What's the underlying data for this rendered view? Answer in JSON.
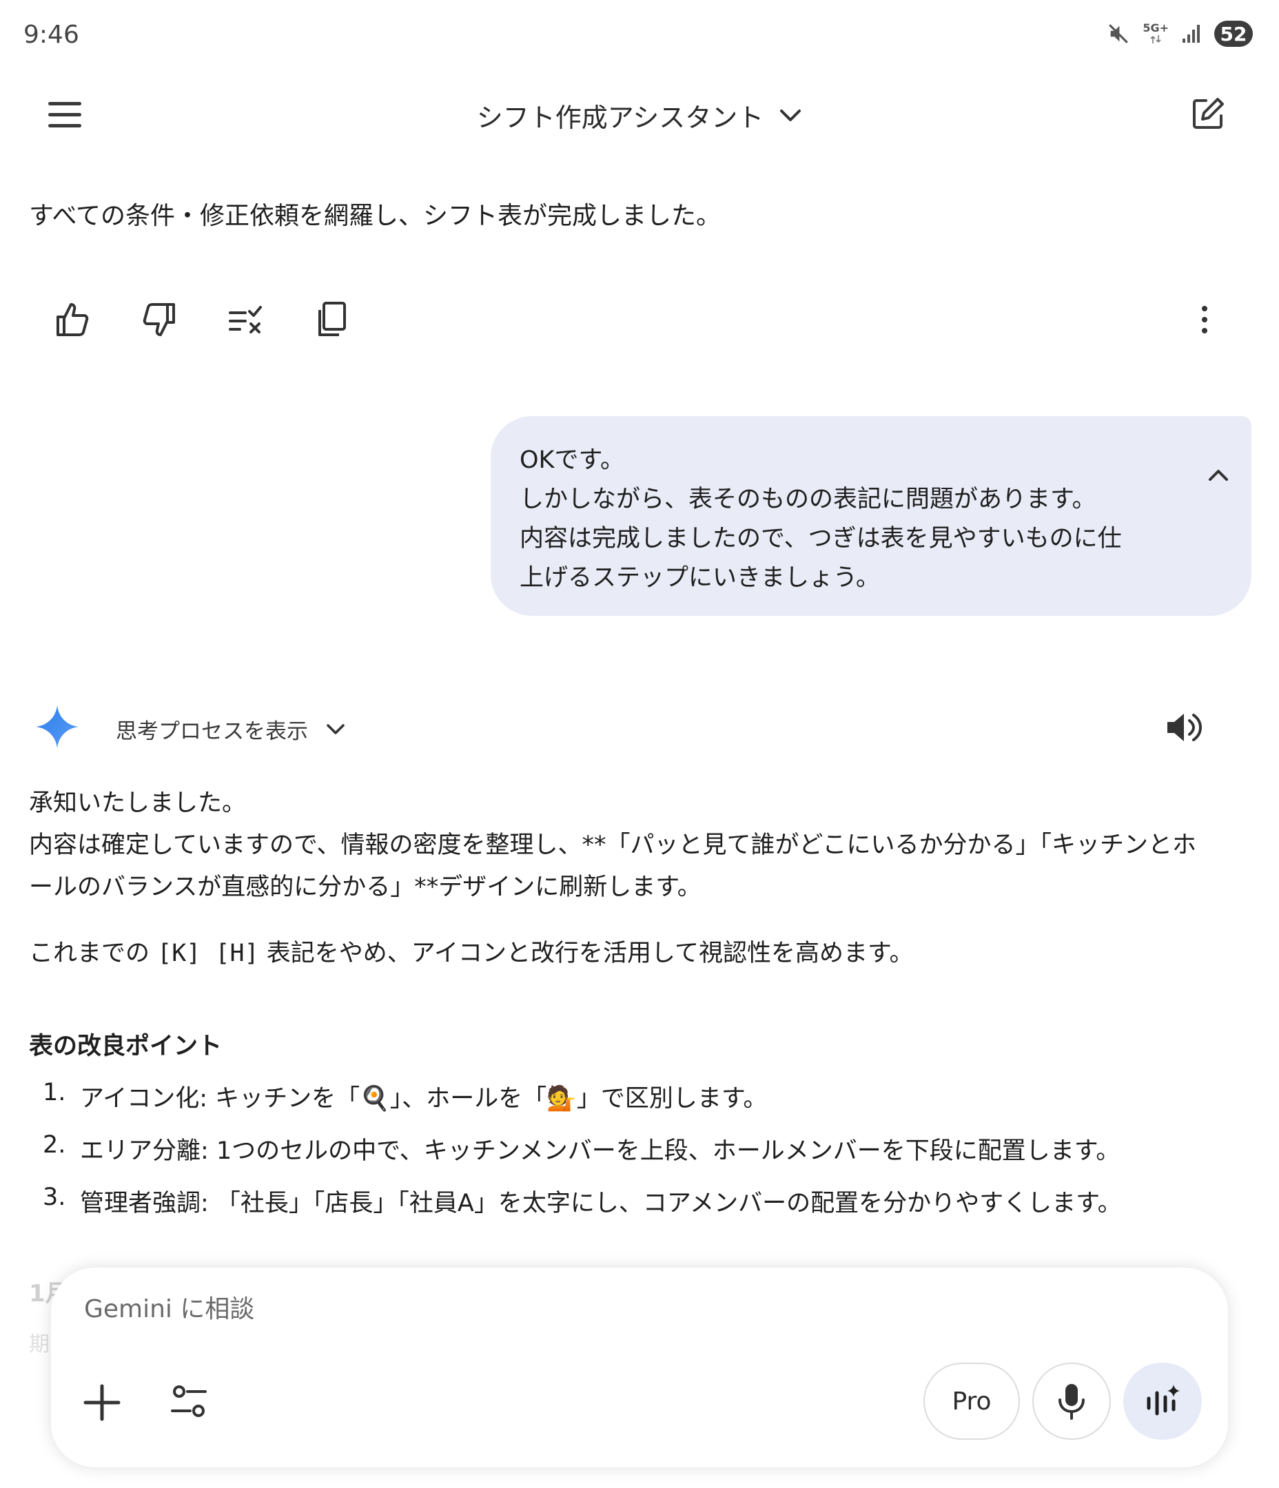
{
  "status_bar": {
    "time": "9:46",
    "network": "5G+",
    "battery": "52"
  },
  "header": {
    "title": "シフト作成アシスタント"
  },
  "conversation": {
    "bot_message_1": "すべての条件・修正依頼を網羅し、シフト表が完成しました。",
    "user_message": [
      "OKです。",
      "しかしながら、表そのものの表記に問題があります。",
      "内容は完成しましたので、つぎは表を見やすいものに仕",
      "上げるステップにいきましょう。"
    ],
    "thinking_toggle_label": "思考プロセスを表示",
    "bot_message_2": {
      "line1": "承知いたしました。",
      "line2": "内容は確定していますので、情報の密度を整理し、**「パッと見て誰がどこにいるか分かる」「キッチンとホ",
      "line3": "ールのバランスが直感的に分かる」**デザインに刷新します。",
      "para2_prefix": "これまでの ",
      "para2_code": "[K] [H]",
      "para2_suffix": " 表記をやめ、アイコンと改行を活用して視認性を高めます。",
      "section_heading": "表の改良ポイント",
      "list": [
        {
          "num": "1.",
          "text": "アイコン化: キッチンを「🍳」、ホールを「💁」で区別します。"
        },
        {
          "num": "2.",
          "text": "エリア分離: 1つのセルの中で、キッチンメンバーを上段、ホールメンバーを下段に配置します。"
        },
        {
          "num": "3.",
          "text": "管理者強調: 「社長」「店長」「社員A」を太字にし、コアメンバーの配置を分かりやすくします。"
        }
      ],
      "faded_heading": "1月",
      "faded_line": "期"
    }
  },
  "input": {
    "placeholder": "Gemini に相談",
    "pro_label": "Pro"
  },
  "colors": {
    "user_bubble": "#e9ebf7",
    "gemini_blue": "#4285f4",
    "live_button": "#e6ebf7"
  }
}
